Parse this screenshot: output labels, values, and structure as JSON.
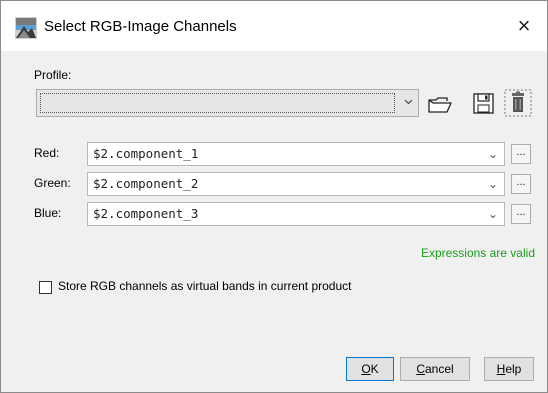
{
  "dialog": {
    "title": "Select RGB-Image Channels",
    "close_glyph": "×"
  },
  "profile": {
    "label": "Profile:",
    "value": ""
  },
  "channels": [
    {
      "label": "Red:",
      "expression": "$2.component_1",
      "more": "..."
    },
    {
      "label": "Green:",
      "expression": "$2.component_2",
      "more": "..."
    },
    {
      "label": "Blue:",
      "expression": "$2.component_3",
      "more": "..."
    }
  ],
  "status": {
    "text": "Expressions are valid",
    "color": "#19a119"
  },
  "options": {
    "virtual_bands_label": "Store RGB channels as virtual bands in current product",
    "virtual_bands_checked": false
  },
  "buttons": {
    "ok_mnemonic": "O",
    "ok_rest": "K",
    "cancel_mnemonic": "C",
    "cancel_rest": "ancel",
    "help_mnemonic": "H",
    "help_rest": "elp"
  },
  "icons": {
    "title": "rgb-image-icon",
    "open": "folder-open-icon",
    "save": "floppy-save-icon",
    "delete": "trash-delete-icon",
    "dropdown": "chevron-down-icon"
  }
}
